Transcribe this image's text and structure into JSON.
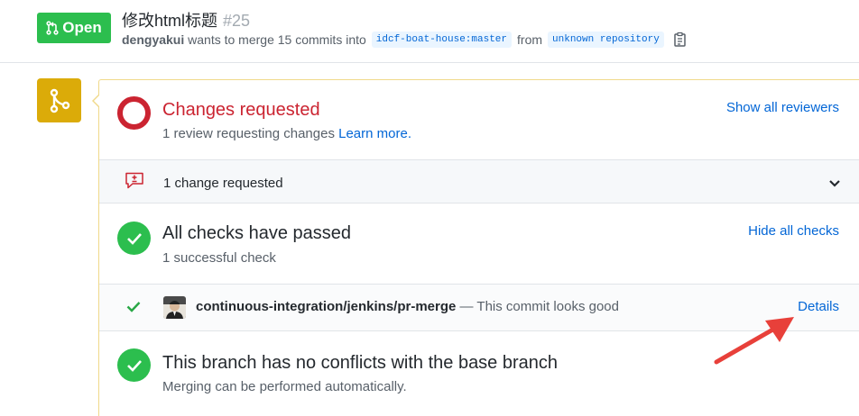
{
  "header": {
    "state_label": "Open",
    "title": "修改html标题",
    "number": "#25",
    "author": "dengyakui",
    "merge_text_pre": "wants to merge 15 commits into",
    "base_branch": "idcf-boat-house:master",
    "from_text": "from",
    "head_branch": "unknown repository"
  },
  "review": {
    "title": "Changes requested",
    "subtitle": "1 review requesting changes",
    "learn_more": "Learn more.",
    "show_reviewers": "Show all reviewers",
    "summary": "1 change requested"
  },
  "checks": {
    "title": "All checks have passed",
    "subtitle": "1 successful check",
    "hide_label": "Hide all checks",
    "items": [
      {
        "name": "continuous-integration/jenkins/pr-merge",
        "description": "— This commit looks good",
        "details_label": "Details"
      }
    ]
  },
  "conflicts": {
    "title": "This branch has no conflicts with the base branch",
    "subtitle": "Merging can be performed automatically."
  },
  "colors": {
    "open_green": "#2cbe4e",
    "changes_red": "#cb2431",
    "link_blue": "#0366d6",
    "merge_icon_yellow": "#dbab09",
    "annotation_arrow": "#e8403a"
  }
}
